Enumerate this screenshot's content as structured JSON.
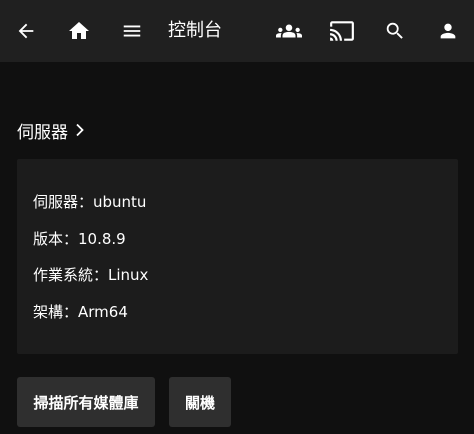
{
  "header": {
    "title": "控制台",
    "icons": {
      "back": "arrow-back-icon",
      "home": "home-icon",
      "menu": "hamburger-menu-icon",
      "users": "users-group-icon",
      "cast": "cast-icon",
      "search": "search-icon",
      "account": "account-icon"
    }
  },
  "section": {
    "label": "伺服器",
    "chevron_icon": "chevron-right-icon"
  },
  "server_info": {
    "server": "伺服器：ubuntu",
    "version": "版本：10.8.9",
    "os": "作業系統：Linux",
    "arch": "架構：Arm64"
  },
  "actions": {
    "scan_label": "掃描所有媒體庫",
    "shutdown_label": "關機"
  },
  "colors": {
    "background": "#101010",
    "header": "#202020",
    "card": "#1c1c1c",
    "button": "#2f2f2f",
    "text": "#ffffff"
  }
}
